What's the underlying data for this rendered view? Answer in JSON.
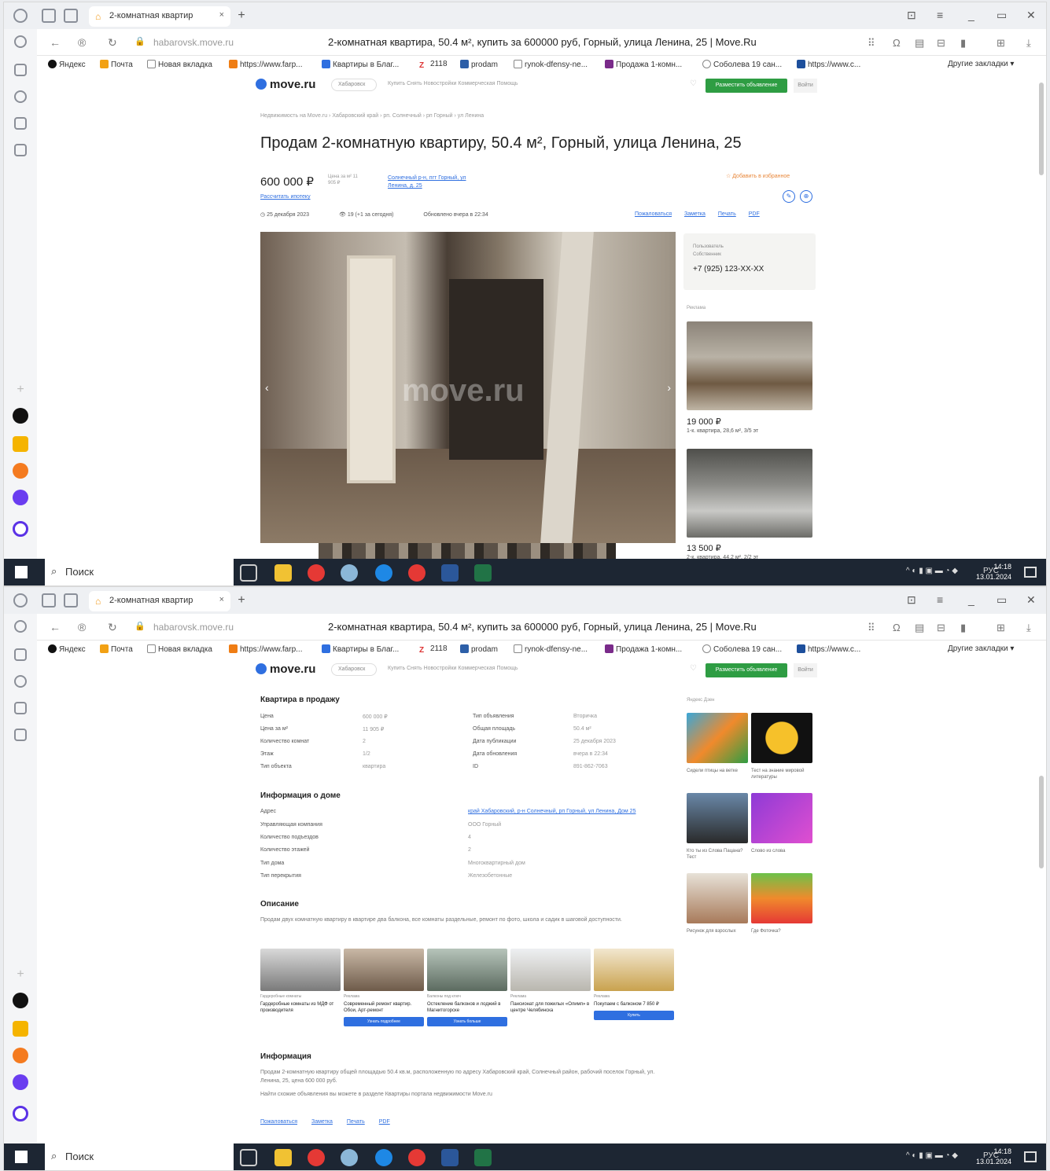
{
  "browser": {
    "tab_title": "2-комнатная квартира, 50.4 м², купить за 600000 руб. Горный, улица Ленина, 25 | Move.Ru",
    "tab_short": "2-комнатная квартир",
    "url": "habarovsk.move.ru",
    "page_title": "2-комнатная квартира, 50.4 м², купить за 600000 руб, Горный, улица Ленина, 25 | Move.Ru",
    "bookmarks": [
      "Яндекс",
      "Почта",
      "Новая вкладка",
      "https://www.farp...",
      "Квартиры в Благ...",
      "2118",
      "prodam",
      "rynok-dfensy-ne...",
      "Продажа 1-комн...",
      "Соболева 19 сан...",
      "https://www.c...",
      "Другие закладки"
    ]
  },
  "taskbar": {
    "search": "Поиск",
    "lang": "РУС",
    "time": "14:18",
    "date": "13.01.2024"
  },
  "site": {
    "logo": "move.ru",
    "region": "Хабаровск",
    "menu": "Купить   Снять   Новостройки   Коммерческая   Помощь",
    "post_button": "Разместить объявление",
    "login_button": "Войти"
  },
  "listing": {
    "breadcrumbs": "Недвижимость на Move.ru  ›  Хабаровский край  ›  рп. Солнечный  ›  рп Горный  ›  ул Ленина",
    "title": "Продам 2-комнатную квартиру, 50.4 м², Горный, улица Ленина, 25",
    "price": "600 000 ₽",
    "price_per_m2": "Цена за м² 11 905 ₽",
    "mortgage": "Рассчитать ипотеку",
    "address_links": "Солнечный р-н, пгт Горный, ул Ленина, д. 25",
    "add_favorite": "Добавить в избранное",
    "date": "25 декабря 2023",
    "views": "19 (+1 за сегодня)",
    "updated": "Обновлено вчера в 22:34",
    "actions": [
      "Пожаловаться",
      "Заметка",
      "Печать",
      "PDF"
    ],
    "watermark": "move.ru"
  },
  "seller": {
    "label1": "Пользователь",
    "label2": "Собственник",
    "phone": "+7 (925) 123-XX-XX"
  },
  "ads": {
    "header": "Реклама",
    "items": [
      {
        "price": "19 000 ₽",
        "desc": "1-к. квартира, 28,6 м², 3/5 эт"
      },
      {
        "price": "13 500 ₽",
        "desc": "2-к. квартира, 44,2 м², 2/2 эт"
      }
    ]
  },
  "details": {
    "title": "Квартира в продажу",
    "left": [
      {
        "k": "Цена",
        "v": "600 000 ₽"
      },
      {
        "k": "Цена за м²",
        "v": "11 905 ₽"
      },
      {
        "k": "Количество комнат",
        "v": "2"
      },
      {
        "k": "Этаж",
        "v": "1/2"
      },
      {
        "k": "Тип объекта",
        "v": "квартира"
      }
    ],
    "right": [
      {
        "k": "Тип объявления",
        "v": "Вторичка"
      },
      {
        "k": "Общая площадь",
        "v": "50.4 м²"
      },
      {
        "k": "Дата публикации",
        "v": "25 декабря 2023"
      },
      {
        "k": "Дата обновления",
        "v": "вчера в 22:34"
      },
      {
        "k": "ID",
        "v": "891-862-7063"
      }
    ]
  },
  "house": {
    "title": "Информация о доме",
    "rows": [
      {
        "k": "Адрес",
        "v": "край Хабаровский, р-н Солнечный, рп Горный, ул Ленина, Дом 25"
      },
      {
        "k": "Управляющая компания",
        "v": "ООО Горный"
      },
      {
        "k": "Количество подъездов",
        "v": "4"
      },
      {
        "k": "Количество этажей",
        "v": "2"
      },
      {
        "k": "Тип дома",
        "v": "Многоквартирный дом"
      },
      {
        "k": "Тип перекрытия",
        "v": "Железобетонные"
      }
    ]
  },
  "description": {
    "title": "Описание",
    "text": "Продам двух комнатную квартиру в квартире два балкона, все комнаты раздельные, ремонт по фото, школа и садик в шаговой доступности."
  },
  "promos": [
    {
      "tag": "Гардеробные комнаты",
      "text": "Гардеробные комнаты из МДФ от производителя",
      "btn": ""
    },
    {
      "tag": "Реклама",
      "text": "Современный ремонт квартир. Обои, Арт-ремонт",
      "btn": "Узнать подробнее"
    },
    {
      "tag": "Балконы под ключ",
      "text": "Остекление балконов и лоджий в Магнитогорске",
      "btn": "Узнать больше"
    },
    {
      "tag": "Реклама",
      "text": "Пансионат для пожилых «Олимп» в центре Челябинска",
      "btn": ""
    },
    {
      "tag": "Реклама",
      "text": "Покупаем с балконом 7 850 ₽",
      "btn": "Купить"
    }
  ],
  "info": {
    "title": "Информация",
    "text1": "Продам 2-комнатную квартиру общей площадью 50.4 кв.м, расположенную по адресу Хабаровский край, Солнечный район, рабочий поселок Горный, ул. Ленина, 25, цена 600 000 руб.",
    "text2": "Найти схожие объявления вы можете в разделе Квартиры портала недвижимости Move.ru",
    "actions": [
      "Пожаловаться",
      "Заметка",
      "Печать",
      "PDF"
    ]
  },
  "zen": {
    "header": "Яндекс Дзен",
    "items": [
      "Сидели птицы на ветке",
      "Тест на знание мировой литературы",
      "Кто ты из Слова Пацана? Тест",
      "Слово из слова",
      "Рисунок для взрослых",
      "Где Фоточка?"
    ]
  },
  "colors": {
    "accent": "#2f6fe0",
    "green": "#2e9d43",
    "taskbar": "#1d2633"
  }
}
